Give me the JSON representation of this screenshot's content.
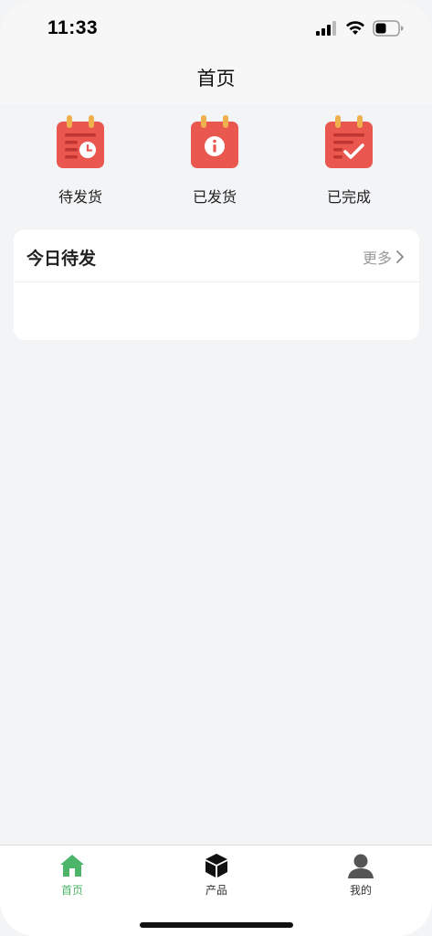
{
  "status_bar": {
    "time": "11:33"
  },
  "nav": {
    "title": "首页"
  },
  "quick_menu": [
    {
      "label": "待发货",
      "icon": "calendar-clock-icon"
    },
    {
      "label": "已发货",
      "icon": "calendar-info-icon"
    },
    {
      "label": "已完成",
      "icon": "calendar-check-icon"
    }
  ],
  "today_card": {
    "title": "今日待发",
    "more_label": "更多"
  },
  "tab_bar": [
    {
      "label": "首页",
      "icon": "home-icon",
      "active": true
    },
    {
      "label": "产品",
      "icon": "box-icon",
      "active": false
    },
    {
      "label": "我的",
      "icon": "user-icon",
      "active": false
    }
  ],
  "colors": {
    "accent_green": "#4db56a",
    "icon_red": "#e9574f",
    "icon_ring": "#f0b04d",
    "page_bg": "#f3f4f6"
  }
}
